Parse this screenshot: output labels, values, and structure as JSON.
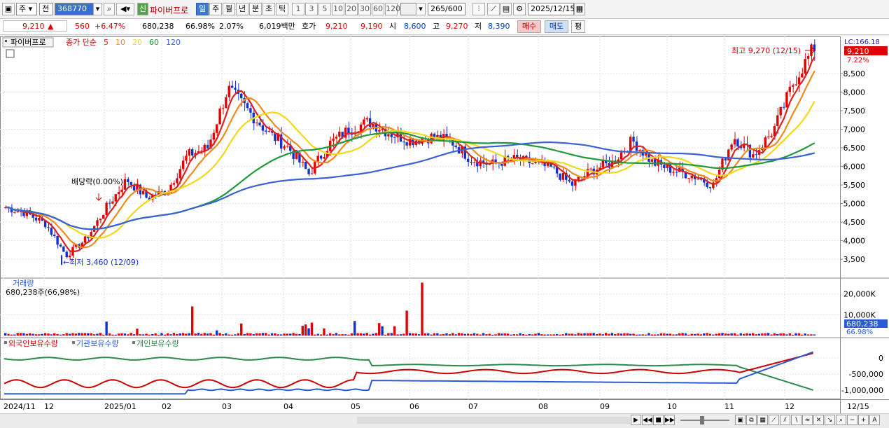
{
  "toolbar": {
    "market": "주",
    "range": "전",
    "code": "368770",
    "sin": "신",
    "name": "파이버프로",
    "periods": [
      "일",
      "주",
      "월",
      "년",
      "분",
      "초",
      "틱"
    ],
    "active_period": "일",
    "intervals": [
      "1",
      "3",
      "5",
      "10",
      "20",
      "30",
      "60",
      "120"
    ],
    "count": "265",
    "count_total": "/600",
    "date": "2025/12/15"
  },
  "quote": {
    "price": "9,210",
    "arrow": "▲",
    "change": "560",
    "change_pct": "+6.47%",
    "volume": "680,238",
    "vol_pct": "66.98%",
    "turnover_pct": "2.07%",
    "amount": "6,019백만",
    "bid_label": "호가",
    "bid1": "9,210",
    "bid2": "9,190",
    "open_label": "시",
    "open": "8,600",
    "high_label": "고",
    "high": "9,270",
    "low_label": "저",
    "low": "8,390",
    "buy": "매수",
    "sell": "매도",
    "avg": "평"
  },
  "legend": {
    "name": "파이버프로",
    "label": "종가 단순",
    "ma": [
      {
        "period": "5",
        "color": "#e02020"
      },
      {
        "period": "10",
        "color": "#f08a1a"
      },
      {
        "period": "20",
        "color": "#f2d81a"
      },
      {
        "period": "60",
        "color": "#1f9a3a"
      },
      {
        "period": "120",
        "color": "#3a62d6"
      }
    ]
  },
  "annotations": {
    "high": "최고 9,270 (12/15)",
    "low": "←최저 3,460 (12/09)",
    "dividend": "배당락(0.00%)"
  },
  "price_axis": {
    "ticks": [
      "8,500",
      "8,000",
      "7,500",
      "7,000",
      "6,500",
      "6,000",
      "5,500",
      "5,000",
      "4,500",
      "4,000",
      "3,500"
    ],
    "lc": "LC:166.18",
    "current": "9,210",
    "pct": "7.22%"
  },
  "volume": {
    "title": "거래량",
    "value": "680,238주(66,98%)",
    "ticks": [
      "20,000K",
      "10,000K"
    ],
    "current": "680,238",
    "pct": "66.98%"
  },
  "holdings": {
    "labels": [
      {
        "text": "외국인보유수량",
        "color": "#d00000"
      },
      {
        "text": "기관보유수량",
        "color": "#2a5bd7"
      },
      {
        "text": "개인보유수량",
        "color": "#2a8a4a"
      }
    ],
    "ticks": [
      "0",
      "-500,000",
      "-1,000,000"
    ]
  },
  "x_axis": {
    "labels": [
      "2024/11",
      "12",
      "2025/01",
      "02",
      "03",
      "04",
      "05",
      "06",
      "07",
      "08",
      "09",
      "10",
      "11",
      "12"
    ],
    "last": "12/15"
  },
  "chart_data": {
    "type": "candlestick",
    "ylim": [
      3200,
      9500
    ],
    "points": [
      [
        "2024/11-start",
        4900
      ],
      [
        "2024/11",
        4750
      ],
      [
        "2024/12-early",
        4450
      ],
      [
        "2024/12/09",
        3600
      ],
      [
        "2024/12-late",
        4050
      ],
      [
        "2025/01-early",
        4900
      ],
      [
        "2025/01-mid",
        5650
      ],
      [
        "2025/01-late",
        5150
      ],
      [
        "2025/02-early",
        5350
      ],
      [
        "2025/02-mid",
        6300
      ],
      [
        "2025/02-late",
        6500
      ],
      [
        "2025/03-early",
        8100
      ],
      [
        "2025/03-mid",
        7500
      ],
      [
        "2025/03-late",
        6900
      ],
      [
        "2025/04-early",
        6500
      ],
      [
        "2025/04-mid",
        5800
      ],
      [
        "2025/04-late",
        6600
      ],
      [
        "2025/05-early",
        7000
      ],
      [
        "2025/05-mid",
        7200
      ],
      [
        "2025/05-late",
        6900
      ],
      [
        "2025/06-early",
        6700
      ],
      [
        "2025/06-mid",
        6800
      ],
      [
        "2025/06-late",
        6700
      ],
      [
        "2025/07-early",
        6200
      ],
      [
        "2025/07-mid",
        6050
      ],
      [
        "2025/07-late",
        6200
      ],
      [
        "2025/08-early",
        6100
      ],
      [
        "2025/08-mid",
        5950
      ],
      [
        "2025/08-late",
        5500
      ],
      [
        "2025/09-early",
        5900
      ],
      [
        "2025/09-mid",
        6100
      ],
      [
        "2025/09-late",
        6700
      ],
      [
        "2025/10-early",
        6100
      ],
      [
        "2025/10-mid",
        5900
      ],
      [
        "2025/10-late",
        5750
      ],
      [
        "2025/11-early",
        5500
      ],
      [
        "2025/11-mid",
        6800
      ],
      [
        "2025/11-late",
        6300
      ],
      [
        "2025/12-early",
        7000
      ],
      [
        "2025/12-mid",
        8300
      ],
      [
        "2025/12/15",
        9210
      ]
    ],
    "high": {
      "date": "12/15",
      "value": 9270
    },
    "low": {
      "date": "12/09",
      "value": 3460
    }
  }
}
